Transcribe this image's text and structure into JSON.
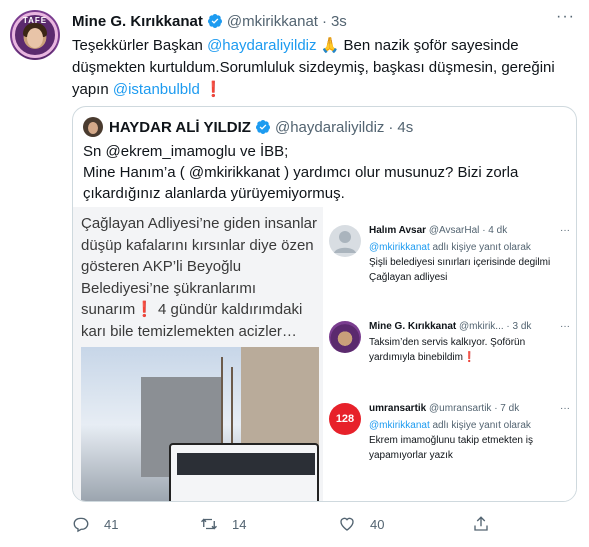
{
  "tweet": {
    "author_name": "Mine G. Kırıkkanat",
    "author_handle": "@mkirikkanat",
    "separator": "·",
    "time": "3s",
    "avatar_text": "TAFE",
    "text_1": "Teşekkürler Başkan ",
    "mention_1": "@haydaraliyildiz",
    "text_2": " Ben nazik şoför sayesinde düşmekten kurtuldum.Sorumluluk sizdeymiş, başkası düşmesin, gereğini yapın ",
    "mention_2": "@istanbulbld",
    "prayer_emoji": "🙏",
    "exclamation": "❗",
    "more": "···"
  },
  "quote": {
    "author_name": "HAYDAR ALİ YILDIZ",
    "author_handle": "@haydaraliyildiz",
    "separator": "·",
    "time": "4s",
    "line_1": "Sn @ekrem_imamoglu ve İBB;",
    "line_2a": "Mine Hanım’a ( @mkirikkanat )   yardımcı olur musunuz? Bizi zorla",
    "line_2b": "çıkardığınız alanlarda yürüyemiyormuş.",
    "photo_text_1": "Çağlayan Adliyesi’ne giden insanlar düşüp kafalarını kırsınlar diye özen gösteren AKP’li Beyoğlu Belediyesi’ne şükranlarımı sunarım",
    "photo_text_2": " 4 gündür kaldırımdaki karı bile temizlemekten acizler…"
  },
  "replies": [
    {
      "name": "Halım Avsar",
      "handle": "@AvsarHal",
      "time": "· 4 dk",
      "sub_mention": "@mkirikkanat",
      "sub_text": " adlı kişiye yanıt olarak",
      "body": "Şişli belediyesi sınırları içerisinde degilmi Çağlayan adliyesi"
    },
    {
      "name": "Mine G. Kırıkkanat",
      "handle": "@mkirik...",
      "time": "· 3 dk",
      "body": "Taksim’den servis kalkıyor. Şoförün yardımıyla binebildim"
    },
    {
      "name": "umransartik",
      "handle": "@umransartik",
      "time": "· 7 dk",
      "avatar_text": "128",
      "sub_mention": "@mkirikkanat",
      "sub_text": " adlı kişiye yanıt olarak",
      "body": "Ekrem imamoğlunu takip etmekten iş yapamıyorlar yazık"
    }
  ],
  "actions": {
    "reply_count": "41",
    "retweet_count": "14",
    "like_count": "40"
  },
  "colors": {
    "accent": "#1d9bf0",
    "text": "#0f1419",
    "muted": "#536471",
    "border": "#cfd9de"
  }
}
